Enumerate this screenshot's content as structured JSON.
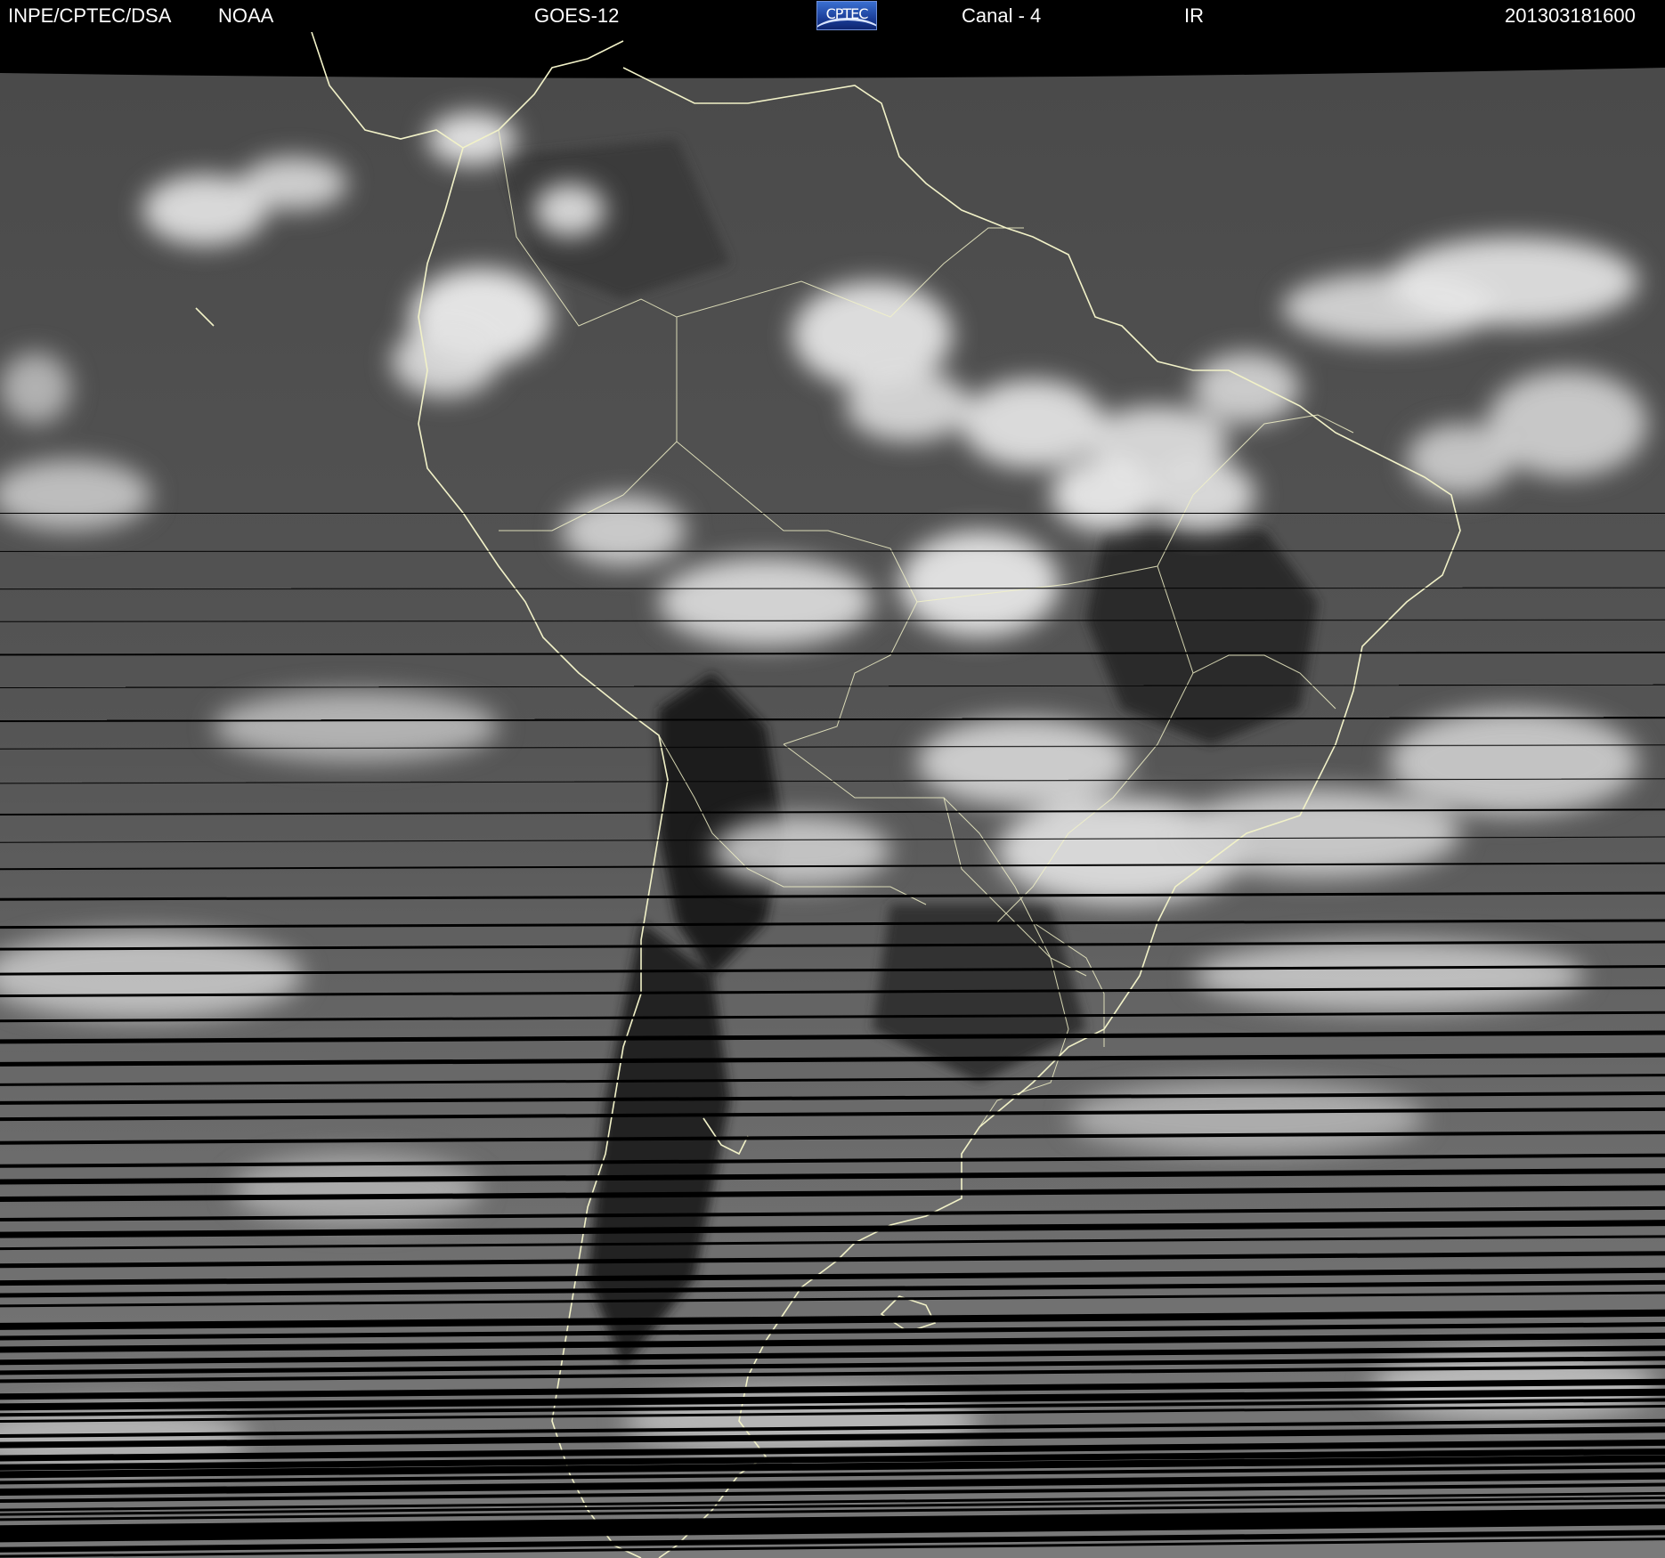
{
  "header": {
    "agency": "INPE/CPTEC/DSA",
    "source": "NOAA",
    "satellite": "GOES-12",
    "logo_text": "CPTEC",
    "channel": "Canal - 4",
    "band": "IR",
    "timestamp": "201303181600"
  },
  "colors": {
    "background": "#000000",
    "header_text": "#ffffff",
    "coastline": "#f2f2c8",
    "logo_blue": "#1c3f9a"
  },
  "image": {
    "type": "satellite infrared image",
    "region": "South America"
  }
}
